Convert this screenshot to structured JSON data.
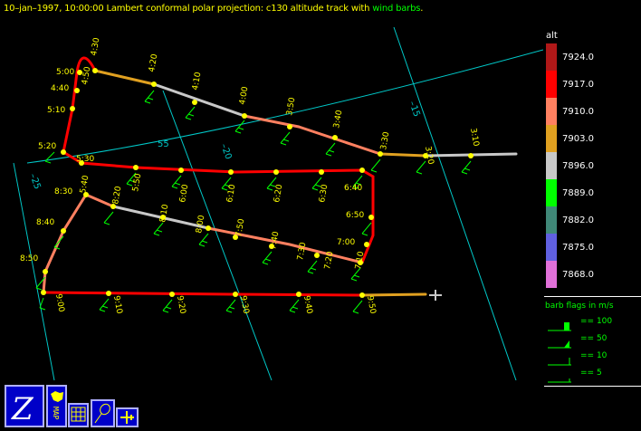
{
  "header": {
    "text_main": "10–jan–1997, 10:00:00  Lambert conformal polar projection:  c130 altitude track with ",
    "text_highlight": "wind barbs",
    "text_end": "."
  },
  "grid_labels": [
    "55",
    "–20",
    "–25",
    "–15"
  ],
  "time_labels": [
    "4:30",
    "4:20",
    "4:10",
    "4:00",
    "3:50",
    "3:40",
    "3:30",
    "3:20",
    "3:10",
    "5:00",
    "4:50",
    "4:40",
    "5:10",
    "5:20",
    "5:30",
    "5:40",
    "5:50",
    "6:00",
    "6:10",
    "6:20",
    "6:30",
    "6:40",
    "8:30",
    "8:20",
    "8:10",
    "8:00",
    "7:50",
    "7:40",
    "7:30",
    "7:20",
    "7:10",
    "7:00",
    "6:50",
    "8:40",
    "8:50",
    "9:00",
    "9:10",
    "9:20",
    "9:30",
    "9:40",
    "9:50"
  ],
  "legend": {
    "title": "alt",
    "values": [
      "7924.0",
      "7917.0",
      "7910.0",
      "7903.0",
      "7896.0",
      "7889.0",
      "7882.0",
      "7875.0",
      "7868.0"
    ],
    "colors": [
      "#b01818",
      "#ff0000",
      "#ff8060",
      "#e0a020",
      "#c8c8c8",
      "#00ff00",
      "#408878",
      "#6060e0",
      "#e070d8"
    ]
  },
  "barbs": {
    "title": "barb flags in m/s",
    "items": [
      "== 100",
      "== 50",
      "== 10",
      "== 5"
    ]
  },
  "toolbar": {
    "buttons": [
      "zebra-logo",
      "map",
      "grid",
      "track",
      "aircraft"
    ],
    "map_label": "MAP"
  }
}
